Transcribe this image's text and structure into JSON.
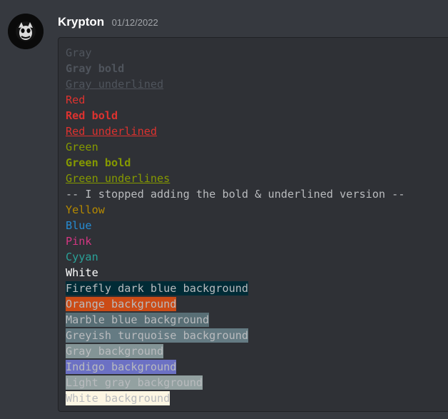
{
  "message": {
    "username": "Krypton",
    "timestamp": "01/12/2022",
    "lines": [
      {
        "text": "Gray",
        "color": "#4f545c"
      },
      {
        "text": "Gray bold",
        "color": "#4f545c",
        "bold": true
      },
      {
        "text": "Gray underlined",
        "color": "#4f545c",
        "underline": true
      },
      {
        "text": "Red",
        "color": "#dc322f"
      },
      {
        "text": "Red bold",
        "color": "#dc322f",
        "bold": true
      },
      {
        "text": "Red underlined",
        "color": "#dc322f",
        "underline": true
      },
      {
        "text": "Green",
        "color": "#859900"
      },
      {
        "text": "Green bold",
        "color": "#859900",
        "bold": true
      },
      {
        "text": "Green underlines",
        "color": "#859900",
        "underline": true
      },
      {
        "text": "-- I stopped adding the bold & underlined version --",
        "color": "#b9bbbe"
      },
      {
        "text": "Yellow",
        "color": "#b58900"
      },
      {
        "text": "Blue",
        "color": "#268bd2"
      },
      {
        "text": "Pink",
        "color": "#d33682"
      },
      {
        "text": "Cyyan",
        "color": "#2aa198"
      },
      {
        "text": "White",
        "color": "#ffffff"
      },
      {
        "text": "Firefly dark blue background",
        "color": "#b9bbbe",
        "bg": "#002b36"
      },
      {
        "text": "Orange background",
        "color": "#b9bbbe",
        "bg": "#cb4b16"
      },
      {
        "text": "Marble blue background",
        "color": "#b9bbbe",
        "bg": "#586e75"
      },
      {
        "text": "Greyish turquoise background",
        "color": "#b9bbbe",
        "bg": "#657b83"
      },
      {
        "text": "Gray background",
        "color": "#b9bbbe",
        "bg": "#839496"
      },
      {
        "text": "Indigo background",
        "color": "#b9bbbe",
        "bg": "#6c71c4"
      },
      {
        "text": "Light gray background",
        "color": "#b9bbbe",
        "bg": "#93a1a1"
      },
      {
        "text": "White background",
        "color": "#b9bbbe",
        "bg": "#fdf6e3"
      }
    ]
  }
}
